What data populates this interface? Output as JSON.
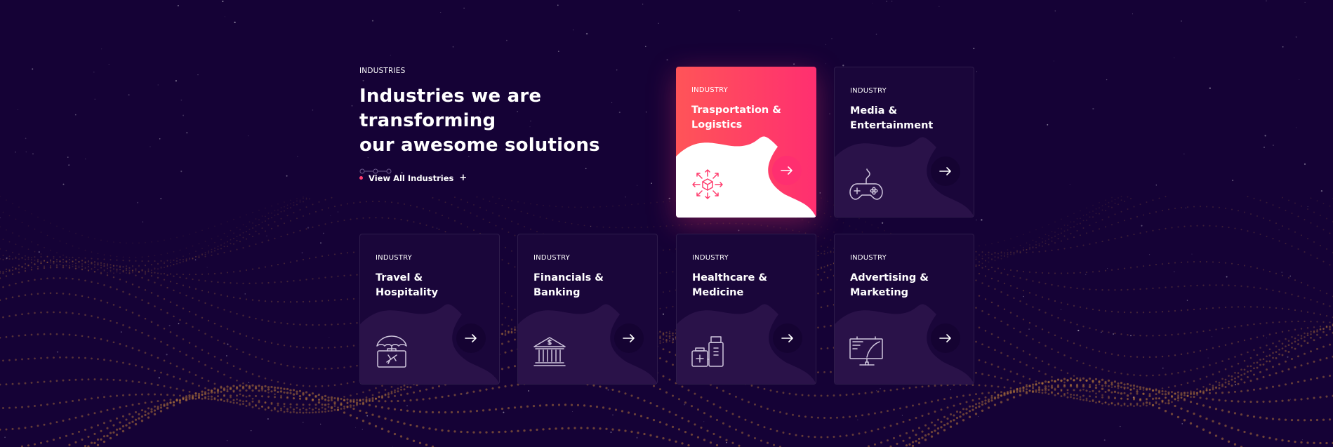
{
  "colors": {
    "background": "#150236",
    "accent": "#ff3d6e",
    "card": "#1a063a",
    "dot_wave": "#b87a3a"
  },
  "intro": {
    "eyebrow": "INDUSTRIES",
    "headline_line1": "Industries we are transforming",
    "headline_line2": "our awesome solutions",
    "cta_label": "View All Industries",
    "cta_icon": "plus-icon"
  },
  "cards": [
    {
      "eyebrow": "INDUSTRY",
      "title_line1": "Trasportation &",
      "title_line2": "Logistics",
      "icon": "logistics-box-icon",
      "active": true
    },
    {
      "eyebrow": "INDUSTRY",
      "title_line1": "Media &",
      "title_line2": "Entertainment",
      "icon": "gamepad-icon",
      "active": false
    },
    {
      "eyebrow": "INDUSTRY",
      "title_line1": "Travel &",
      "title_line2": "Hospitality",
      "icon": "suitcase-umbrella-icon",
      "active": false
    },
    {
      "eyebrow": "INDUSTRY",
      "title_line1": "Financials &",
      "title_line2": "Banking",
      "icon": "bank-icon",
      "active": false
    },
    {
      "eyebrow": "INDUSTRY",
      "title_line1": "Healthcare &",
      "title_line2": "Medicine",
      "icon": "medicine-bottles-icon",
      "active": false
    },
    {
      "eyebrow": "INDUSTRY",
      "title_line1": "Advertising &",
      "title_line2": "Marketing",
      "icon": "billboard-icon",
      "active": false
    }
  ]
}
